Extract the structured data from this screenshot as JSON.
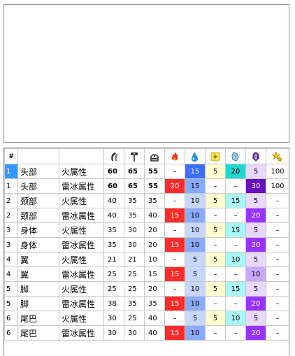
{
  "header": {
    "hash": "#",
    "icons": [
      "claw-icon",
      "hammer-icon",
      "shot-icon",
      "fire-icon",
      "water-icon",
      "thunder-icon",
      "ice-icon",
      "dragon-icon",
      "stun-icon"
    ]
  },
  "rows": [
    {
      "idx": "1",
      "part": "头部",
      "attr": "火属性",
      "a": "60",
      "b": "65",
      "c": "55",
      "fire": "–",
      "water": "15",
      "thunder": "5",
      "ice": "20",
      "dragon": "5",
      "last": "100"
    },
    {
      "idx": "1",
      "part": "头部",
      "attr": "雷冰属性",
      "a": "60",
      "b": "65",
      "c": "55",
      "fire": "20",
      "water": "15",
      "thunder": "–",
      "ice": "–",
      "dragon": "30",
      "last": "100"
    },
    {
      "idx": "2",
      "part": "颈部",
      "attr": "火属性",
      "a": "40",
      "b": "35",
      "c": "35",
      "fire": "–",
      "water": "10",
      "thunder": "5",
      "ice": "15",
      "dragon": "5",
      "last": "–"
    },
    {
      "idx": "2",
      "part": "颈部",
      "attr": "雷冰属性",
      "a": "40",
      "b": "35",
      "c": "40",
      "fire": "15",
      "water": "10",
      "thunder": "–",
      "ice": "–",
      "dragon": "20",
      "last": "–"
    },
    {
      "idx": "3",
      "part": "身体",
      "attr": "火属性",
      "a": "35",
      "b": "30",
      "c": "20",
      "fire": "–",
      "water": "10",
      "thunder": "5",
      "ice": "15",
      "dragon": "5",
      "last": "–"
    },
    {
      "idx": "3",
      "part": "身体",
      "attr": "雷冰属性",
      "a": "35",
      "b": "30",
      "c": "20",
      "fire": "15",
      "water": "10",
      "thunder": "–",
      "ice": "–",
      "dragon": "20",
      "last": "–"
    },
    {
      "idx": "4",
      "part": "翼",
      "attr": "火属性",
      "a": "21",
      "b": "21",
      "c": "10",
      "fire": "–",
      "water": "5",
      "thunder": "5",
      "ice": "10",
      "dragon": "5",
      "last": "–"
    },
    {
      "idx": "4",
      "part": "翼",
      "attr": "雷冰属性",
      "a": "25",
      "b": "25",
      "c": "15",
      "fire": "15",
      "water": "5",
      "thunder": "–",
      "ice": "–",
      "dragon": "10",
      "last": "–"
    },
    {
      "idx": "5",
      "part": "脚",
      "attr": "火属性",
      "a": "25",
      "b": "25",
      "c": "20",
      "fire": "–",
      "water": "10",
      "thunder": "5",
      "ice": "15",
      "dragon": "5",
      "last": "–"
    },
    {
      "idx": "5",
      "part": "脚",
      "attr": "雷冰属性",
      "a": "38",
      "b": "35",
      "c": "35",
      "fire": "15",
      "water": "10",
      "thunder": "–",
      "ice": "–",
      "dragon": "20",
      "last": "–"
    },
    {
      "idx": "6",
      "part": "尾巴",
      "attr": "火属性",
      "a": "30",
      "b": "25",
      "c": "40",
      "fire": "–",
      "water": "5",
      "thunder": "5",
      "ice": "10",
      "dragon": "5",
      "last": "–"
    },
    {
      "idx": "6",
      "part": "尾巴",
      "attr": "雷冰属性",
      "a": "30",
      "b": "30",
      "c": "40",
      "fire": "15",
      "water": "10",
      "thunder": "–",
      "ice": "–",
      "dragon": "20",
      "last": "–"
    }
  ]
}
